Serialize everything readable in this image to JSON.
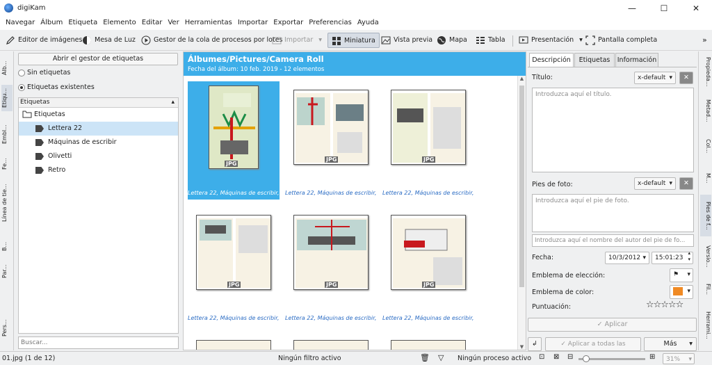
{
  "window": {
    "title": "digiKam",
    "minimize": "—",
    "maximize": "☐",
    "close": "✕"
  },
  "menu": [
    "Navegar",
    "Álbum",
    "Etiqueta",
    "Elemento",
    "Editar",
    "Ver",
    "Herramientas",
    "Importar",
    "Exportar",
    "Preferencias",
    "Ayuda"
  ],
  "toolbar": {
    "image_editor": "Editor de imágenes",
    "light_table": "Mesa de Luz",
    "batch_queue": "Gestor de la cola de procesos por lotes",
    "import": "Importar",
    "thumbnail": "Miniatura",
    "preview": "Vista previa",
    "map": "Mapa",
    "table": "Tabla",
    "presentation": "Presentación",
    "fullscreen": "Pantalla completa",
    "more": "»"
  },
  "left_tabs": [
    "Álb...",
    "Etiqu...",
    "Embl...",
    "Fe...",
    "Línea de tie...",
    "B...",
    "Par...",
    "Pers..."
  ],
  "right_tabs": [
    "Propieda...",
    "Metad...",
    "Col...",
    "M...",
    "Pies de f...",
    "Versio...",
    "Fil...",
    "Herrami..."
  ],
  "tag_panel": {
    "open_manager": "Abrir el gestor de etiquetas",
    "no_tags": "Sin etiquetas",
    "existing_tags": "Etiquetas existentes",
    "column_header": "Etiquetas",
    "root": "Etiquetas",
    "tags": [
      "Lettera 22",
      "Máquinas de escribir",
      "Olivetti",
      "Retro"
    ],
    "search_placeholder": "Buscar..."
  },
  "album": {
    "path": "Álbumes/Pictures/Camera Roll",
    "subtitle": "Fecha del álbum: 10 feb. 2019 - 12 elementos",
    "badge": "JPG",
    "captions": [
      "Lettera 22, Máquinas de escribir, ...",
      "Lettera 22, Máquinas de escribir, ...",
      "Lettera 22, Máquinas de escribir, ...",
      "Lettera 22, Máquinas de escribir, ...",
      "Lettera 22, Máquinas de escribir, ...",
      "Lettera 22, Máquinas de escribir, ..."
    ]
  },
  "right_panel": {
    "tabs": [
      "Descripción",
      "Etiquetas",
      "Información"
    ],
    "title_label": "Título:",
    "lang": "x-default",
    "title_placeholder": "Introduzca aquí el título.",
    "caption_label": "Pies de foto:",
    "caption_placeholder": "Introduzca aquí el pie de foto.",
    "author_placeholder": "Introduzca aquí el nombre del autor del pie de fo...",
    "date_label": "Fecha:",
    "date_value": "10/3/2012",
    "time_value": "15:01:23",
    "pick_label": "Emblema de elección:",
    "color_label": "Emblema de color:",
    "rating_label": "Puntuación:",
    "stars": "☆☆☆☆☆",
    "apply": "✓ Aplicar",
    "apply_all": "✓ Aplicar a todas las versiones",
    "more": "Más"
  },
  "status": {
    "item": "01.jpg (1 de 12)",
    "filter": "Ningún filtro activo",
    "process": "Ningún proceso activo",
    "zoom": "31%"
  },
  "colors": {
    "accent": "#3daee9",
    "caption_text": "#2b6cc4"
  }
}
